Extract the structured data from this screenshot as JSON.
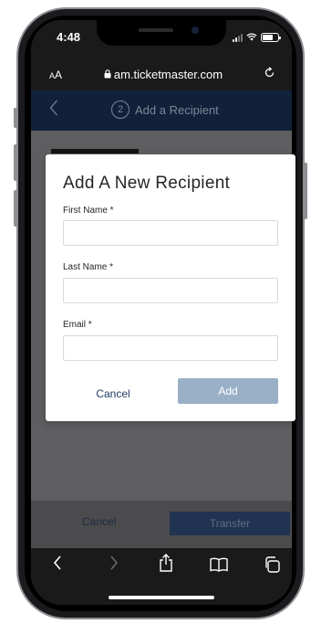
{
  "status_bar": {
    "time": "4:48"
  },
  "url_bar": {
    "aa_small": "A",
    "aa_large": "A",
    "url": "am.ticketmaster.com"
  },
  "nav": {
    "step_number": "2",
    "step_title": "Add a Recipient"
  },
  "modal": {
    "title": "Add A New Recipient",
    "first_name_label": "First Name *",
    "last_name_label": "Last Name *",
    "email_label": "Email *",
    "first_name_value": "",
    "last_name_value": "",
    "email_value": "",
    "cancel_label": "Cancel",
    "add_label": "Add"
  },
  "footer": {
    "cancel_label": "Cancel",
    "transfer_label": "Transfer"
  },
  "icons": {
    "back": "chevron-left-icon",
    "forward": "chevron-right-icon",
    "share": "share-icon",
    "bookmarks": "book-icon",
    "tabs": "tabs-icon",
    "reload": "reload-icon",
    "lock": "lock-icon"
  },
  "colors": {
    "nav_bg": "#11213a",
    "add_button": "#9ab0c6",
    "transfer_button": "#203350",
    "browser_chrome": "#1a1a1a"
  }
}
